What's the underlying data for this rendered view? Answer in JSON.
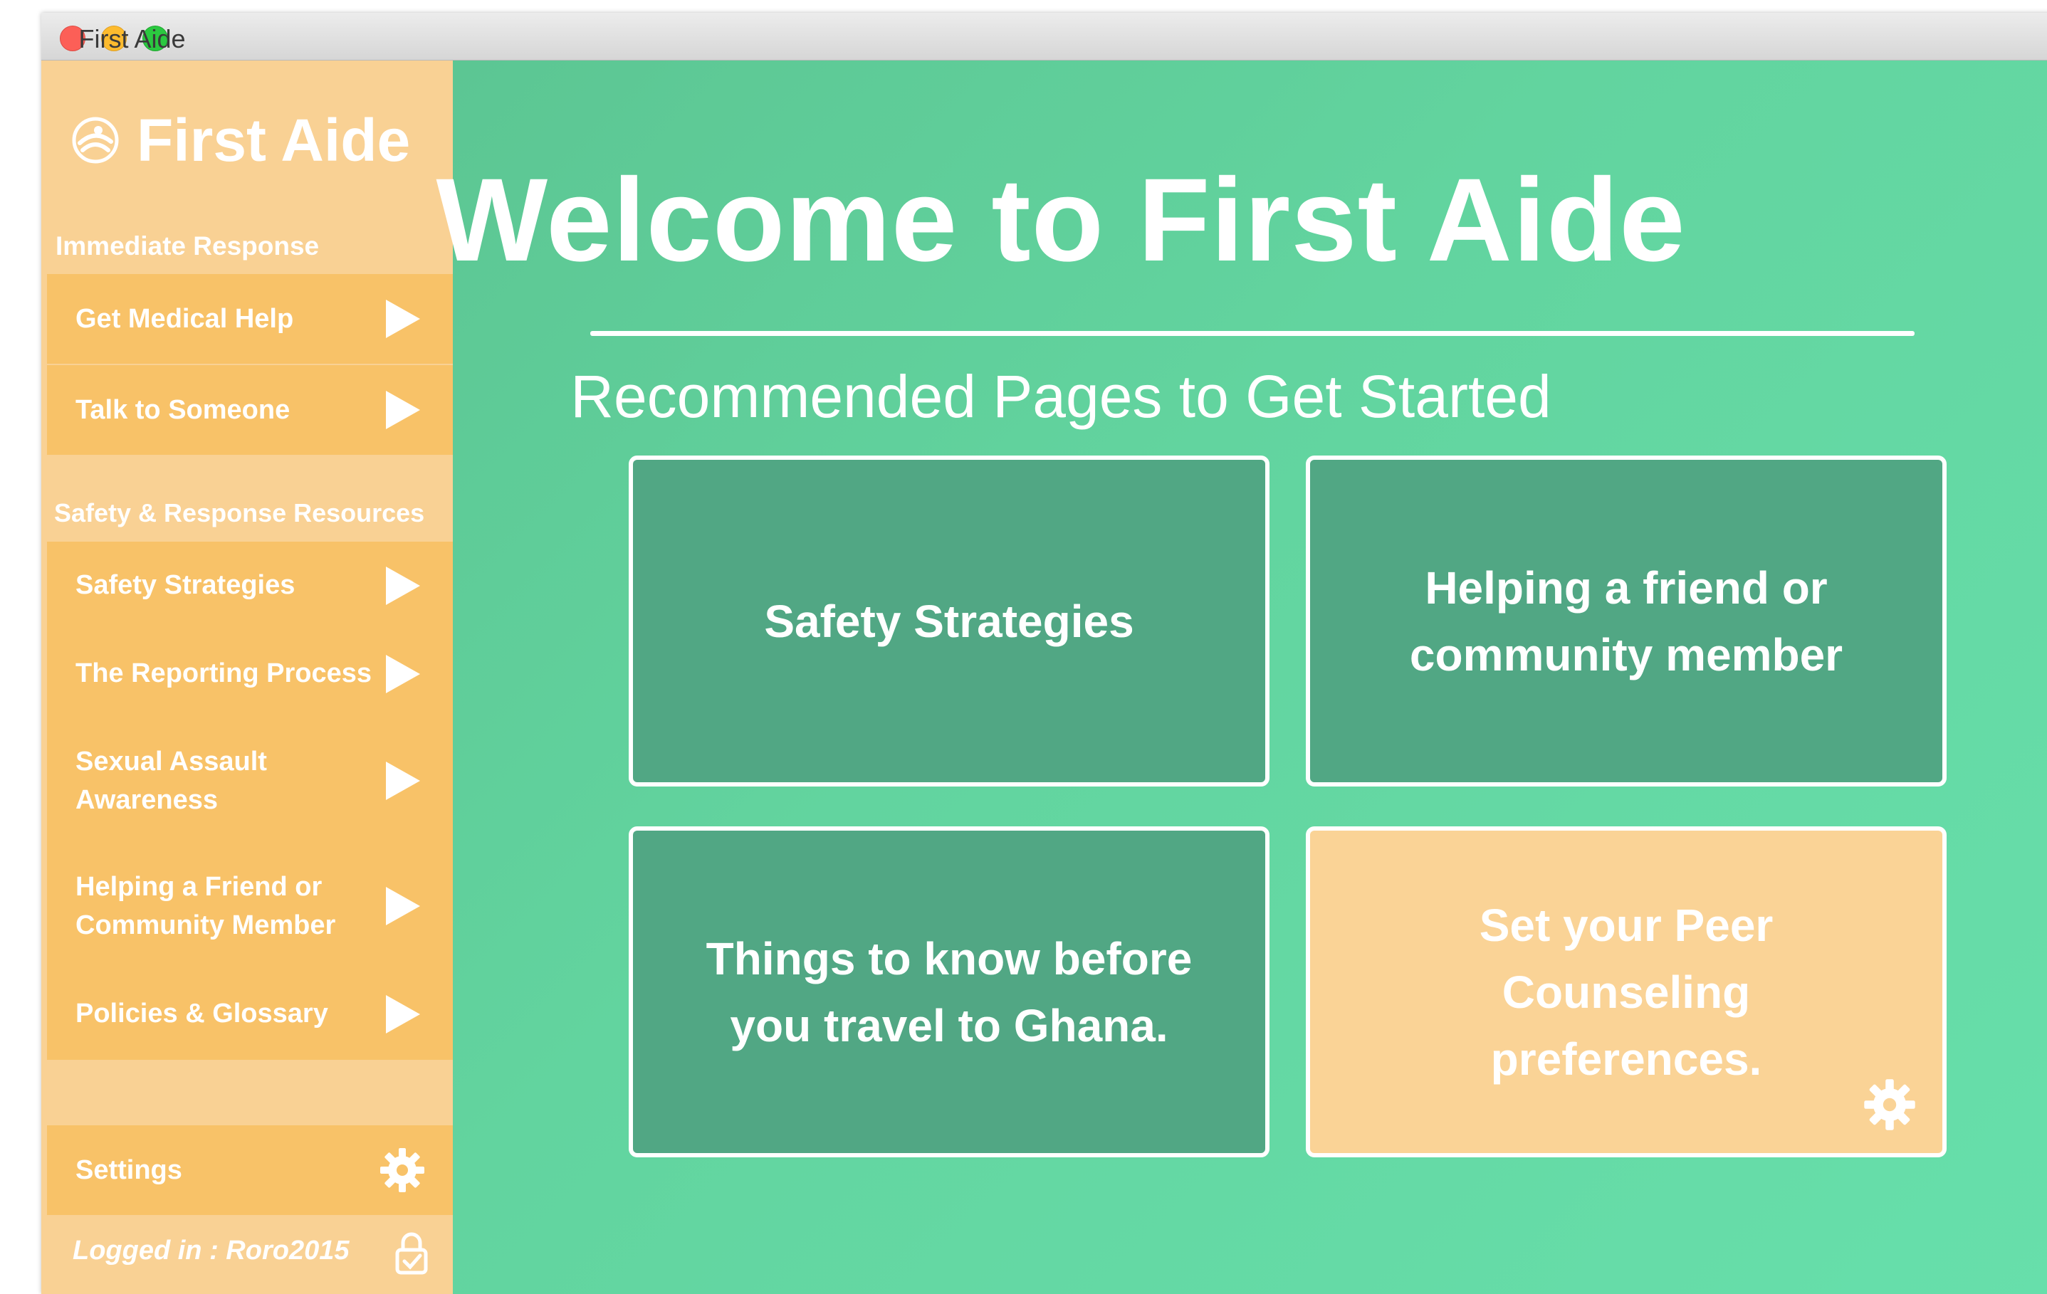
{
  "window": {
    "title": "First Aide"
  },
  "sidebar": {
    "logo_text": "First Aide",
    "section_immediate": "Immediate Response",
    "immediate_items": [
      {
        "label": "Get Medical Help"
      },
      {
        "label": "Talk to Someone"
      }
    ],
    "section_resources": "Safety & Response Resources",
    "resource_items": [
      {
        "label": "Safety Strategies"
      },
      {
        "label": "The Reporting Process"
      },
      {
        "label": "Sexual Assault Awareness"
      },
      {
        "label": "Helping a Friend or Community Member"
      },
      {
        "label": "Policies & Glossary"
      }
    ],
    "settings_label": "Settings",
    "logged_in_text": "Logged in : Roro2015"
  },
  "main": {
    "welcome_title": "Welcome to First Aide",
    "subtitle": "Recommended Pages to Get Started",
    "cards": [
      {
        "label": "Safety Strategies"
      },
      {
        "label": "Helping a friend or community member"
      },
      {
        "label": "Things to know before you travel to Ghana."
      },
      {
        "label": "Set your Peer Counseling preferences."
      }
    ]
  },
  "colors": {
    "sidebar_bg": "#f9d194",
    "nav_item_bg": "#f8c268",
    "main_green": "#62d49f",
    "card_green": "#51a784",
    "card_orange": "#fad396"
  }
}
